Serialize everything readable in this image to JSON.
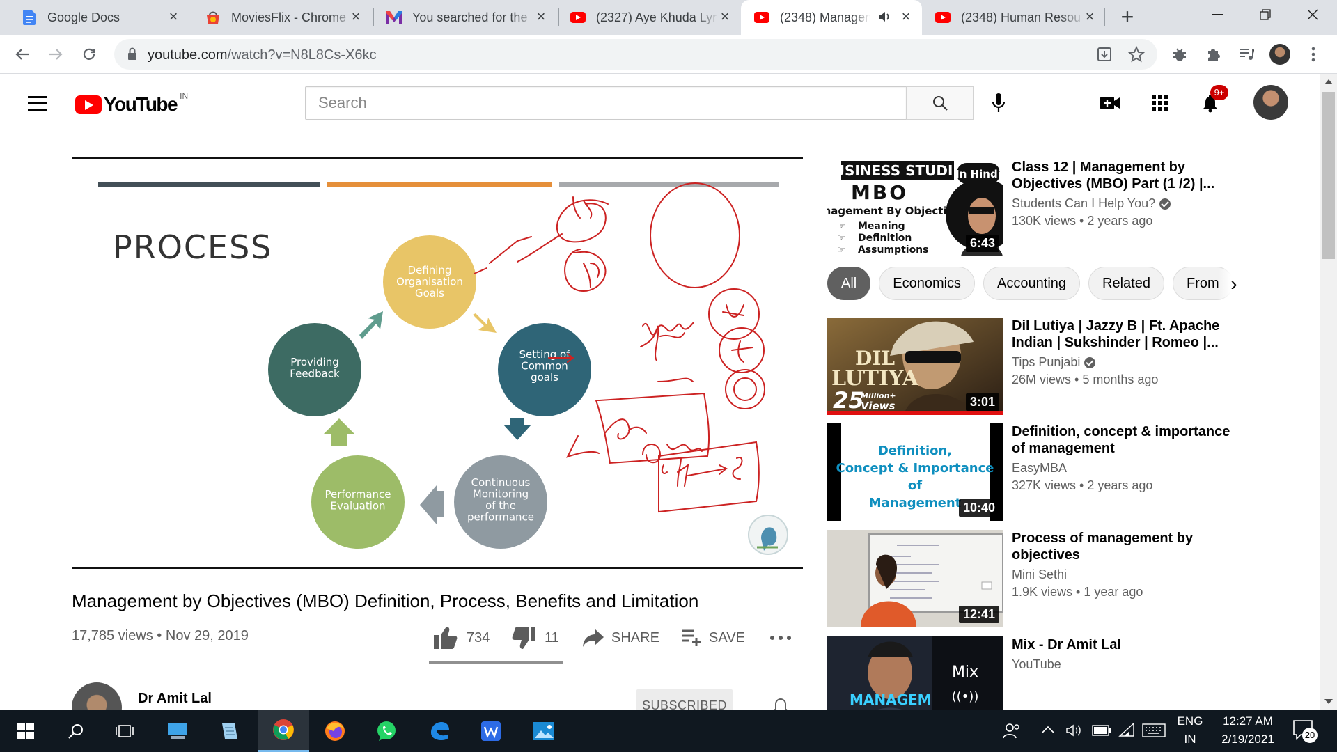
{
  "browser": {
    "tabs": [
      {
        "title": "Google Docs",
        "icon": "google-docs-icon"
      },
      {
        "title": "MoviesFlix - Chrome",
        "icon": "chrome-web-store-icon"
      },
      {
        "title": "You searched for the",
        "icon": "gmail-like-m-icon"
      },
      {
        "title": "(2327) Aye Khuda Lyr",
        "icon": "youtube-icon"
      },
      {
        "title": "(2348) Managem",
        "icon": "youtube-icon",
        "active": true
      },
      {
        "title": "(2348) Human Resou",
        "icon": "youtube-icon"
      }
    ],
    "url_host": "youtube.com",
    "url_path": "/watch?v=N8L8Cs-X6kc"
  },
  "youtube": {
    "country_code": "IN",
    "search_placeholder": "Search",
    "notification_count": "9+"
  },
  "video": {
    "slide": {
      "heading": "PROCESS",
      "bar_colors": [
        "#434f57",
        "#e58f3a",
        "#a7a9ac"
      ],
      "steps": [
        {
          "label": [
            "Defining",
            "Organisation",
            "Goals"
          ],
          "color": "#e8c567"
        },
        {
          "label": [
            "Setting of",
            "Common",
            "goals"
          ],
          "color": "#2f6577"
        },
        {
          "label": [
            "Continuous",
            "Monitoring",
            "of  the",
            "performance"
          ],
          "color": "#8f9aa1"
        },
        {
          "label": [
            "Performance",
            "Evaluation"
          ],
          "color": "#9dbc68"
        },
        {
          "label": [
            "Providing",
            "Feedback"
          ],
          "color": "#3d6b63"
        }
      ],
      "annotation_color": "#cc2222"
    },
    "title": "Management by Objectives (MBO) Definition, Process, Benefits and Limitation",
    "views": "17,785 views",
    "date": "Nov 29, 2019",
    "likes": "734",
    "dislikes": "11",
    "share_label": "SHARE",
    "save_label": "SAVE",
    "channel": "Dr Amit Lal",
    "subscribe_label": "SUBSCRIBED"
  },
  "chips": [
    "All",
    "Economics",
    "Accounting",
    "Related",
    "From"
  ],
  "related": [
    {
      "title": "Class 12 | Management by Objectives (MBO) Part (1 /2) |...",
      "channel": "Students Can I Help You?",
      "verified": true,
      "stats": "130K views • 2 years ago",
      "duration": "6:43",
      "thumb_text": [
        "BUSINESS STUDIES",
        "MBO",
        "(Management By Objectives)",
        "Meaning",
        "Definition",
        "Assumptions"
      ],
      "thumb_badge": "In Hindi"
    },
    {
      "title": "Dil Lutiya | Jazzy B | Ft. Apache Indian | Sukshinder | Romeo |...",
      "channel": "Tips Punjabi",
      "verified": true,
      "stats": "26M views • 5 months ago",
      "duration": "3:01",
      "thumb_text": [
        "DIL",
        "LUTIYA",
        "25",
        "Million+",
        "Views"
      ]
    },
    {
      "title": "Definition, concept & importance of management",
      "channel": "EasyMBA",
      "verified": false,
      "stats": "327K views • 2 years ago",
      "duration": "10:40",
      "thumb_text": [
        "Definition,",
        "Concept & Importance",
        "of",
        "Management"
      ]
    },
    {
      "title": "Process of management by objectives",
      "channel": "Mini Sethi",
      "verified": false,
      "stats": "1.9K views • 1 year ago",
      "duration": "12:41"
    },
    {
      "title": "Mix - Dr Amit Lal",
      "channel": "YouTube",
      "verified": false,
      "stats": "",
      "duration": "",
      "thumb_text": [
        "Mix",
        "MANAGEM"
      ]
    }
  ],
  "taskbar": {
    "lang_top": "ENG",
    "lang_bottom": "IN",
    "time": "12:27 AM",
    "date": "2/19/2021",
    "notif_count": "20"
  }
}
